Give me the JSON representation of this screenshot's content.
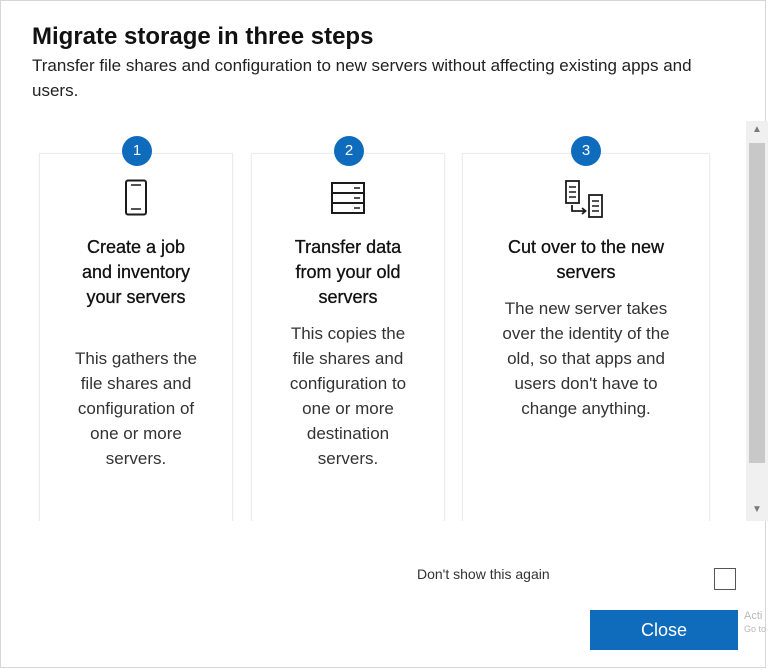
{
  "dialog": {
    "title": "Migrate storage in three steps",
    "subtitle": "Transfer file shares and configuration to new servers without affecting existing apps and users."
  },
  "steps": [
    {
      "number": "1",
      "icon": "phone-device-icon",
      "heading": "Create a job and inventory your servers",
      "description": "This gathers the file shares and configuration of one or more servers."
    },
    {
      "number": "2",
      "icon": "server-rack-icon",
      "heading": "Transfer data from your old servers",
      "description": "This copies the file shares and configuration to one or more destination servers."
    },
    {
      "number": "3",
      "icon": "server-cutover-icon",
      "heading": "Cut over to the new servers",
      "description": "The new server takes over the identity of the old, so that apps and users don't have to change anything."
    }
  ],
  "footer": {
    "dont_show_label": "Don't show this again",
    "dont_show_checked": false,
    "close_label": "Close"
  },
  "watermark": {
    "line1": "Acti",
    "line2": "Go to"
  },
  "colors": {
    "accent": "#0f6cbd",
    "scroll_track": "#f0f0f0",
    "scroll_thumb": "#c8c8c8"
  }
}
